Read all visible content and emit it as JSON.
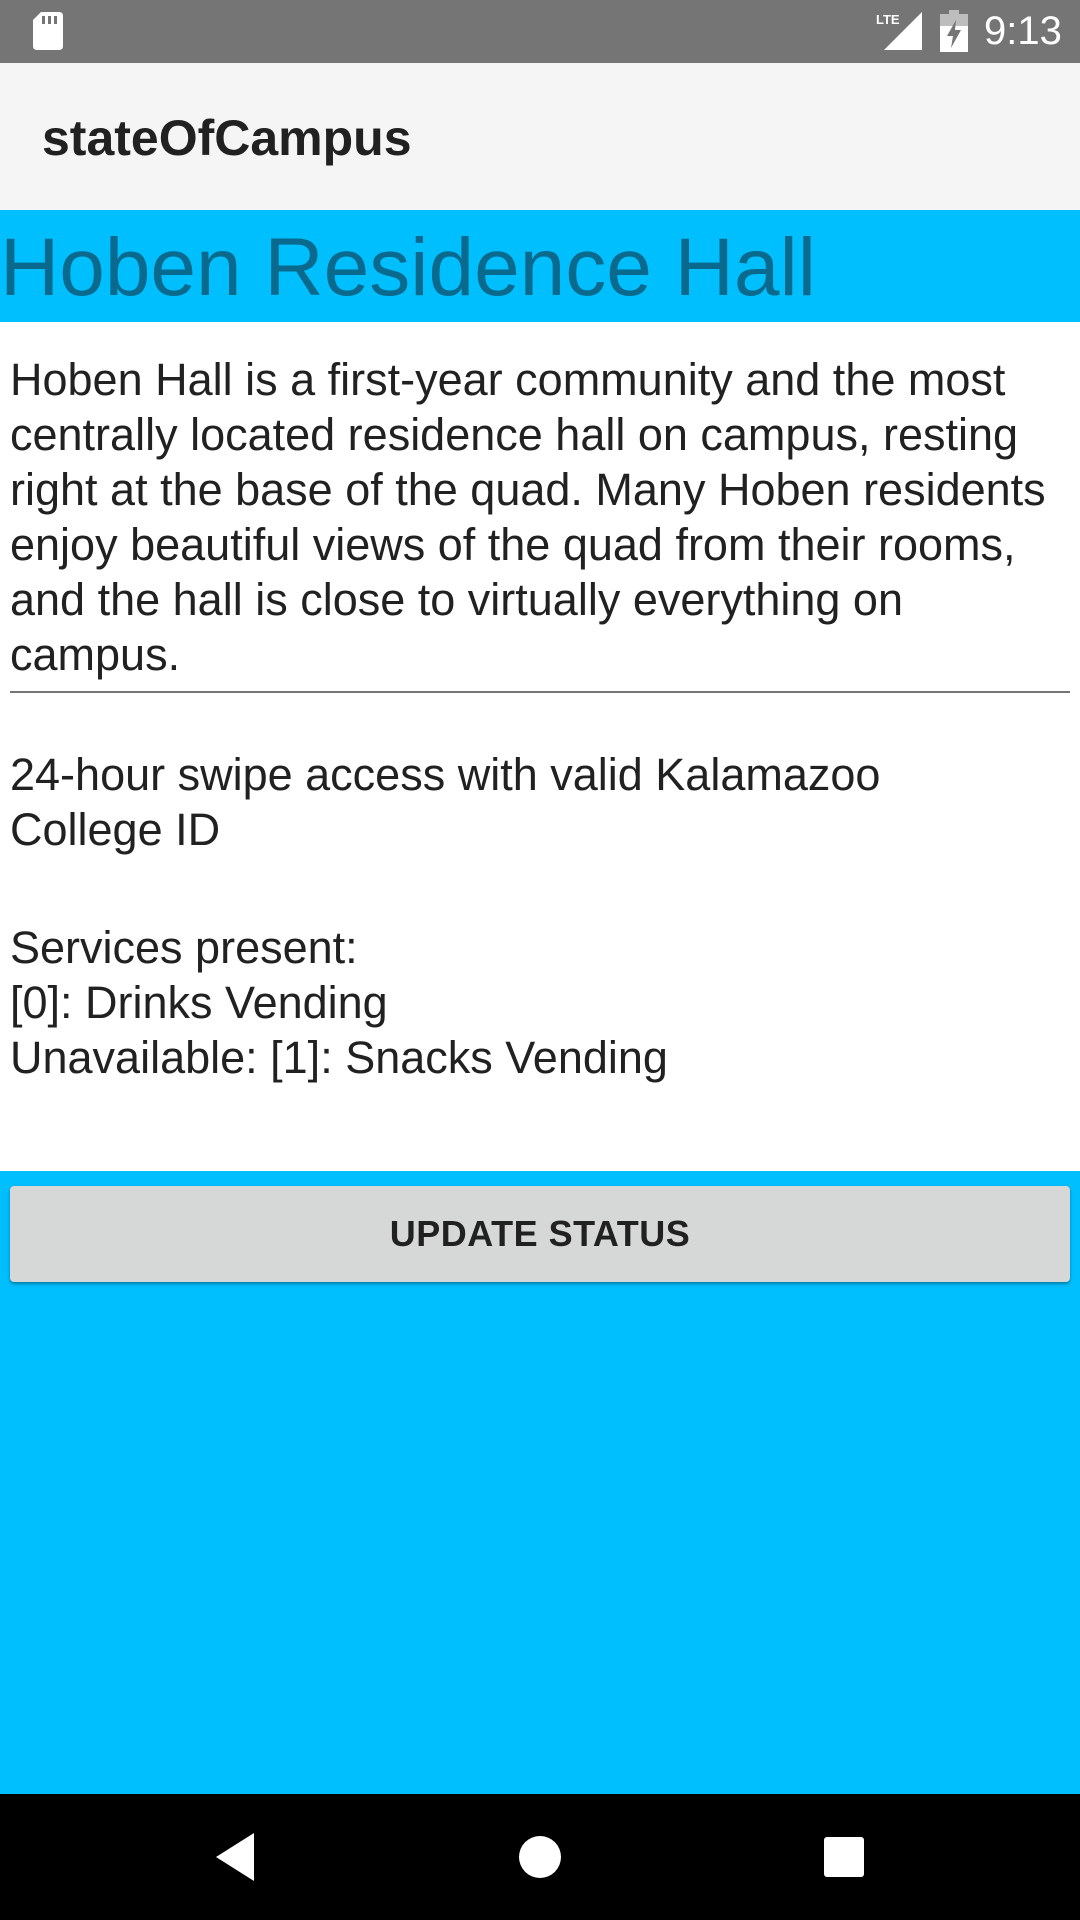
{
  "status_bar": {
    "time": "9:13",
    "icons": [
      "sd-card-icon",
      "lte-signal-icon",
      "battery-charging-icon"
    ]
  },
  "app_bar": {
    "title": "stateOfCampus"
  },
  "hall": {
    "name": "Hoben Residence Hall",
    "description": "Hoben Hall is a first-year community and the most centrally located residence hall on campus, resting right at the base of the quad. Many Hoben residents enjoy beautiful views of the quad from their rooms, and the hall is close to virtually everything on campus.",
    "access": "24-hour swipe access with valid Kalamazoo College ID",
    "services_heading": "Services present:",
    "services_present": "[0]: Drinks Vending",
    "services_unavailable": "Unavailable: [1]: Snacks Vending"
  },
  "actions": {
    "update_label": "UPDATE STATUS"
  },
  "nav_bar": {
    "icons": [
      "back-icon",
      "home-icon",
      "recent-apps-icon"
    ]
  },
  "colors": {
    "accent": "#00bfff",
    "hall_name": "#0a6a8e",
    "status_bar": "#757575",
    "app_bar": "#f5f5f5",
    "button": "#d6d7d7"
  }
}
